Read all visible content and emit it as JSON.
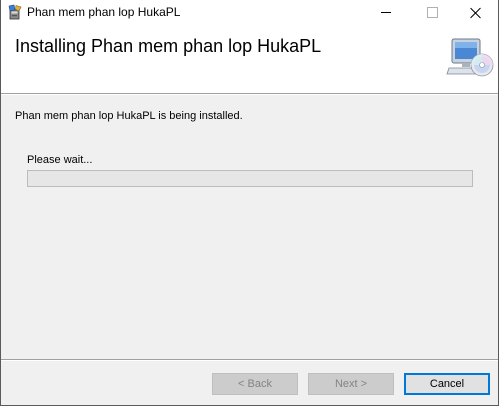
{
  "window": {
    "title": "Phan mem phan lop HukaPL",
    "app_icon": "installer-package-icon"
  },
  "header": {
    "title": "Installing Phan mem phan lop HukaPL",
    "icon": "computer-cd-icon"
  },
  "main": {
    "status_text": "Phan mem phan lop HukaPL is being installed.",
    "wait_label": "Please wait...",
    "progress_percent": 0
  },
  "footer": {
    "back_label": "< Back",
    "next_label": "Next >",
    "cancel_label": "Cancel"
  },
  "colors": {
    "accent": "#0078d7",
    "dialog_bg": "#f0f0f0",
    "progress_fill": "#06b025"
  }
}
